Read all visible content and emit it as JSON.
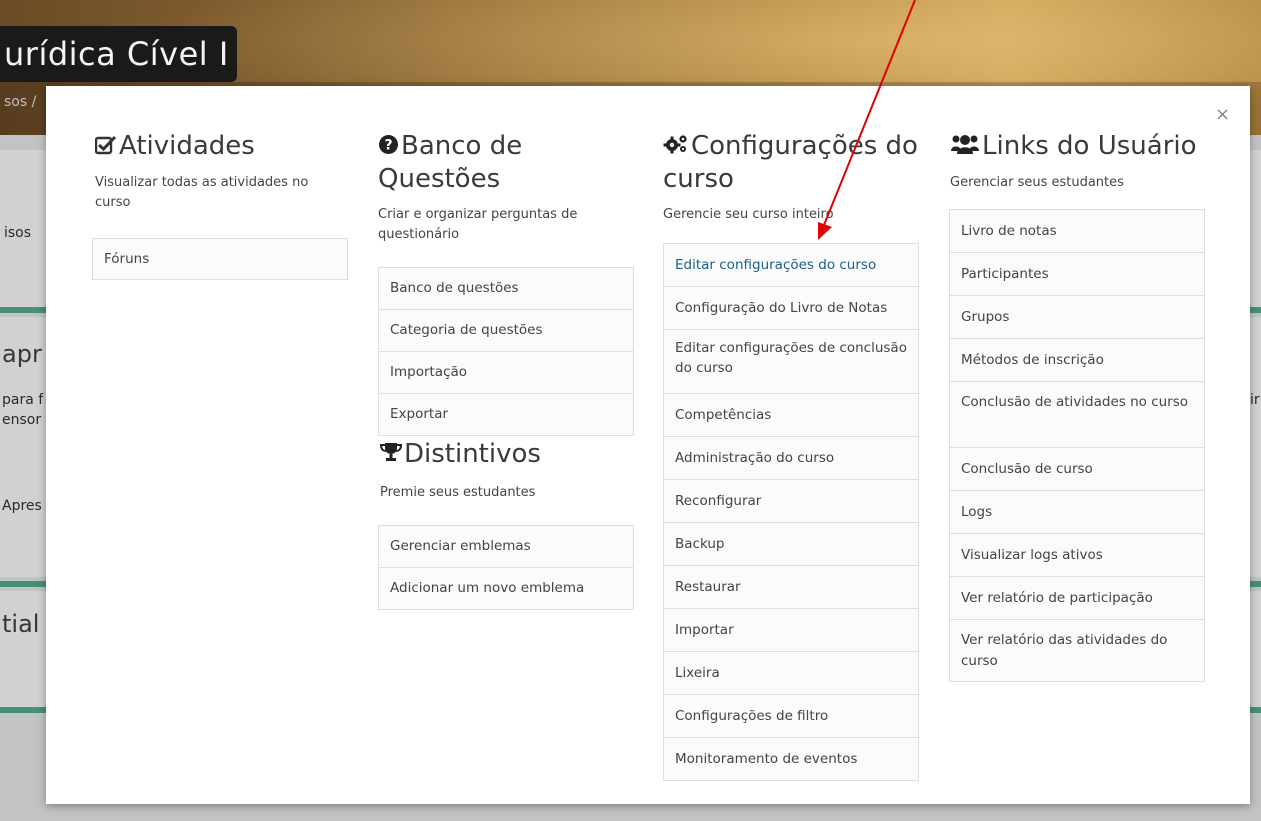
{
  "background": {
    "course_title": "urídica Cível I",
    "breadcrumb": "sos /",
    "fragments": [
      "isos",
      "apr",
      "para f",
      "ensor",
      "Apres",
      "tial",
      "ir"
    ]
  },
  "modal": {
    "close_label": "×",
    "activities": {
      "title": "Atividades",
      "description": "Visualizar todas as atividades no curso",
      "items": [
        "Fóruns"
      ]
    },
    "question_bank": {
      "title": "Banco de Questões",
      "description": "Criar e organizar perguntas de questionário",
      "items": [
        "Banco de questões",
        "Categoria de questões",
        "Importação",
        "Exportar"
      ]
    },
    "badges": {
      "title": "Distintivos",
      "description": "Premie seus estudantes",
      "items": [
        "Gerenciar emblemas",
        "Adicionar um novo emblema"
      ]
    },
    "course_settings": {
      "title": "Configurações do curso",
      "description": "Gerencie seu curso inteiro",
      "items": [
        "Editar configurações do curso",
        "Configuração do Livro de Notas",
        "Editar configurações de conclusão do curso",
        "Competências",
        "Administração do curso",
        "Reconfigurar",
        "Backup",
        "Restaurar",
        "Importar",
        "Lixeira",
        "Configurações de filtro",
        "Monitoramento de eventos"
      ]
    },
    "user_links": {
      "title": "Links do Usuário",
      "description": "Gerenciar seus estudantes",
      "items": [
        "Livro de notas",
        "Participantes",
        "Grupos",
        "Métodos de inscrição",
        "Conclusão de atividades no curso",
        "Conclusão de curso",
        "Logs",
        "Visualizar logs ativos",
        "Ver relatório de participação",
        "Ver relatório das atividades do curso"
      ]
    }
  },
  "colors": {
    "active_link": "#1b5f8c",
    "annotation_arrow": "#e00000",
    "section_accent": "#57b08c"
  },
  "icons": {
    "activities": "checkbox-icon",
    "question_bank": "question-circle-icon",
    "badges": "trophy-icon",
    "course_settings": "cogs-icon",
    "user_links": "users-icon"
  }
}
